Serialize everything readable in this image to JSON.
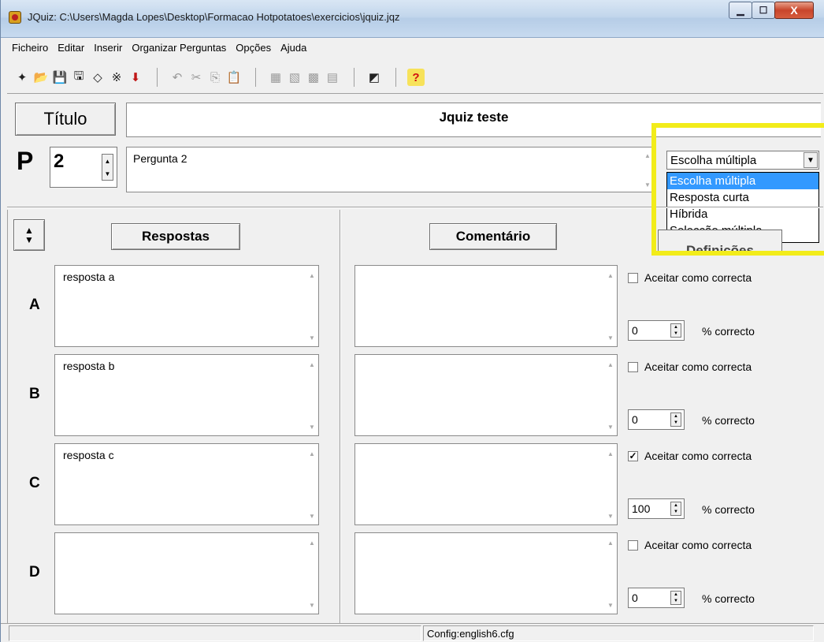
{
  "window": {
    "title": "JQuiz: C:\\Users\\Magda Lopes\\Desktop\\Formacao Hotpotatoes\\exercicios\\jquiz.jqz",
    "controls": {
      "minimize": "▁",
      "maximize": "☐",
      "close": "X"
    }
  },
  "menu": [
    "Ficheiro",
    "Editar",
    "Inserir",
    "Organizar Perguntas",
    "Opções",
    "Ajuda"
  ],
  "toolbar": {
    "groups": [
      [
        {
          "name": "new-file-icon",
          "glyph": "✦",
          "enabled": true
        },
        {
          "name": "open-folder-icon",
          "glyph": "📂",
          "enabled": true
        },
        {
          "name": "save-icon",
          "glyph": "💾",
          "enabled": true
        },
        {
          "name": "save-as-icon",
          "glyph": "🖫",
          "enabled": true
        },
        {
          "name": "eraser-icon",
          "glyph": "◇",
          "enabled": true
        },
        {
          "name": "web-export-icon",
          "glyph": "※",
          "enabled": true
        },
        {
          "name": "arrow-down-icon",
          "glyph": "⬇",
          "enabled": true
        }
      ],
      [
        {
          "name": "undo-icon",
          "glyph": "↶",
          "enabled": false
        },
        {
          "name": "cut-icon",
          "glyph": "✂",
          "enabled": false
        },
        {
          "name": "copy-icon",
          "glyph": "⎘",
          "enabled": false
        },
        {
          "name": "paste-icon",
          "glyph": "📋",
          "enabled": false
        }
      ],
      [
        {
          "name": "add-question-icon",
          "glyph": "▦",
          "enabled": false
        },
        {
          "name": "insert-image-icon",
          "glyph": "▧",
          "enabled": false
        },
        {
          "name": "link-icon",
          "glyph": "▩",
          "enabled": false
        },
        {
          "name": "media-icon",
          "glyph": "▤",
          "enabled": false
        }
      ],
      [
        {
          "name": "config-icon",
          "glyph": "◩",
          "enabled": true
        }
      ],
      [
        {
          "name": "help-icon",
          "glyph": "?",
          "enabled": true
        }
      ]
    ]
  },
  "title_section": {
    "button_label": "Título",
    "value": "Jquiz teste"
  },
  "question": {
    "label": "P",
    "number": "2",
    "text": "Pergunta 2",
    "type_selected": "Escolha múltipla",
    "type_options": [
      "Escolha múltipla",
      "Resposta curta",
      "Híbrida",
      "Selecção múltipla"
    ]
  },
  "headers": {
    "answers": "Respostas",
    "comment": "Comentário",
    "settings": "Definições"
  },
  "answers": [
    {
      "letter": "A",
      "text": "resposta a",
      "comment": "",
      "accept_label": "Aceitar como correcta",
      "checked": false,
      "percent": "0",
      "percent_label": "% correcto"
    },
    {
      "letter": "B",
      "text": "resposta b",
      "comment": "",
      "accept_label": "Aceitar como correcta",
      "checked": false,
      "percent": "0",
      "percent_label": "% correcto"
    },
    {
      "letter": "C",
      "text": "resposta c",
      "comment": "",
      "accept_label": "Aceitar como correcta",
      "checked": true,
      "percent": "100",
      "percent_label": "% correcto"
    },
    {
      "letter": "D",
      "text": "",
      "comment": "",
      "accept_label": "Aceitar como correcta",
      "checked": false,
      "percent": "0",
      "percent_label": "% correcto"
    }
  ],
  "status": {
    "config": "Config:english6.cfg"
  },
  "colors": {
    "highlight": "#f2ec1a",
    "selection": "#3399ff"
  }
}
